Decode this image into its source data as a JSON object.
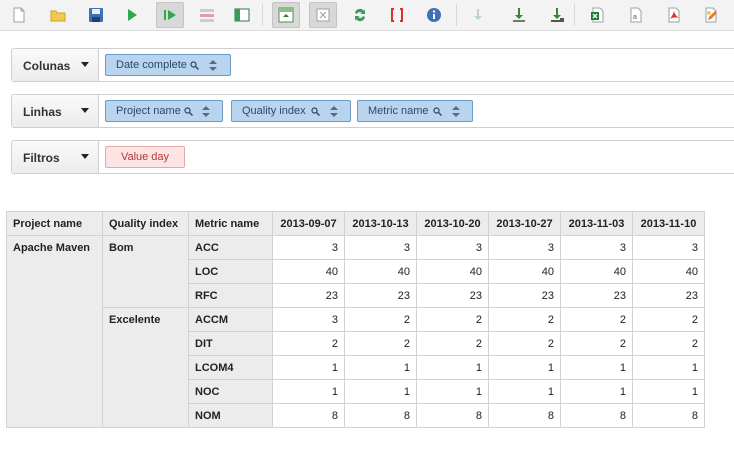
{
  "toolbar": {
    "buttons": [
      {
        "name": "new-icon"
      },
      {
        "name": "open-folder-icon"
      },
      {
        "name": "save-icon"
      },
      {
        "name": "run-icon"
      },
      {
        "name": "run-auto-icon"
      },
      {
        "name": "layout-icon"
      },
      {
        "name": "hide-parents-icon"
      },
      {
        "name": "pivot-table-icon"
      },
      {
        "name": "empty-cells-icon"
      },
      {
        "name": "swap-axes-icon"
      },
      {
        "name": "mdx-icon"
      },
      {
        "name": "info-icon"
      },
      {
        "name": "drill-disabled-icon"
      },
      {
        "name": "export-down-icon"
      },
      {
        "name": "export-drill-icon"
      },
      {
        "name": "excel-icon"
      },
      {
        "name": "csv-icon"
      },
      {
        "name": "pdf-icon"
      },
      {
        "name": "chart-edit-icon"
      }
    ]
  },
  "axes": {
    "columns": {
      "label": "Colunas",
      "chips": [
        {
          "label": "Date complete"
        }
      ]
    },
    "rows": {
      "label": "Linhas",
      "chips": [
        {
          "label": "Project name"
        },
        {
          "label": "Quality index"
        },
        {
          "label": "Metric name"
        }
      ]
    },
    "filters": {
      "label": "Filtros",
      "chips": [
        {
          "label": "Value day"
        }
      ]
    }
  },
  "table": {
    "headers": [
      "Project name",
      "Quality index",
      "Metric name",
      "2013-09-07",
      "2013-10-13",
      "2013-10-20",
      "2013-10-27",
      "2013-11-03",
      "2013-11-10"
    ],
    "project": "Apache Maven",
    "groups": [
      {
        "quality": "Bom",
        "rows": [
          {
            "metric": "ACC",
            "values": [
              "3",
              "3",
              "3",
              "3",
              "3",
              "3"
            ]
          },
          {
            "metric": "LOC",
            "values": [
              "40",
              "40",
              "40",
              "40",
              "40",
              "40"
            ]
          },
          {
            "metric": "RFC",
            "values": [
              "23",
              "23",
              "23",
              "23",
              "23",
              "23"
            ]
          }
        ]
      },
      {
        "quality": "Excelente",
        "rows": [
          {
            "metric": "ACCM",
            "values": [
              "3",
              "2",
              "2",
              "2",
              "2",
              "2"
            ]
          },
          {
            "metric": "DIT",
            "values": [
              "2",
              "2",
              "2",
              "2",
              "2",
              "2"
            ]
          },
          {
            "metric": "LCOM4",
            "values": [
              "1",
              "1",
              "1",
              "1",
              "1",
              "1"
            ]
          },
          {
            "metric": "NOC",
            "values": [
              "1",
              "1",
              "1",
              "1",
              "1",
              "1"
            ]
          },
          {
            "metric": "NOM",
            "values": [
              "8",
              "8",
              "8",
              "8",
              "8",
              "8"
            ]
          }
        ]
      }
    ]
  }
}
